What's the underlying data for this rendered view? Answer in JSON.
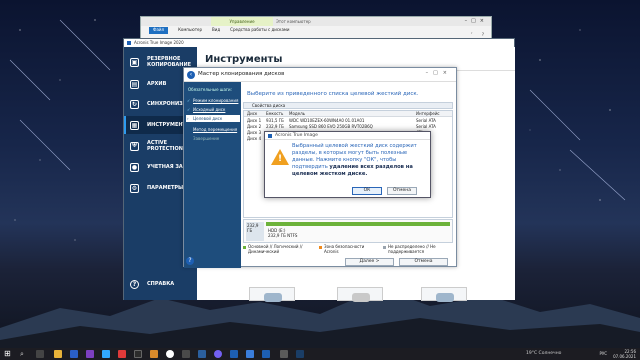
{
  "explorer": {
    "tab_manage": "Управление",
    "tab_title": "Этот компьютер",
    "ribbon": [
      "Файл",
      "Компьютер",
      "Вид",
      "Средства работы с дисками"
    ]
  },
  "app": {
    "title": "Acronis True Image 2020",
    "accent": "#1a3d66",
    "nav": [
      {
        "label": "РЕЗЕРВНОЕ КОПИРОВАНИЕ",
        "icon": "backup-icon"
      },
      {
        "label": "АРХИВ",
        "icon": "archive-icon"
      },
      {
        "label": "СИНХРОНИЗАЦИЯ",
        "icon": "sync-icon"
      },
      {
        "label": "ИНСТРУМЕНТЫ",
        "icon": "tools-icon"
      },
      {
        "label": "ACTIVE PROTECTION",
        "icon": "shield-icon"
      },
      {
        "label": "УЧЕТНАЯ ЗАПИ",
        "icon": "account-icon"
      },
      {
        "label": "ПАРАМЕТРЫ",
        "icon": "gear-icon"
      }
    ],
    "help_label": "СПРАВКА",
    "page_title": "Инструменты"
  },
  "wizard": {
    "title": "Мастер клонирования дисков",
    "steps_header": "Обязательные шаги:",
    "steps": [
      {
        "label": "Режим клонирования",
        "done": true
      },
      {
        "label": "Исходный диск",
        "done": true
      },
      {
        "label": "Целевой диск",
        "done": false,
        "active": true
      },
      {
        "label": "Метод перемещения",
        "done": false
      },
      {
        "label": "Завершение",
        "done": false
      }
    ],
    "prompt": "Выберите из приведенного списка целевой жесткий диск.",
    "toolbar_label": "Свойства диска",
    "columns": [
      "Диск",
      "Емкость",
      "Модель",
      "Интерфейс"
    ],
    "disks": [
      {
        "disk": "Диск 1",
        "capacity": "931,5 ГБ",
        "model": "WDC WD10EZEX-60WN4A0 01.01A01",
        "interface": "Serial ATA"
      },
      {
        "disk": "Диск 2",
        "capacity": "232,9 ГБ",
        "model": "Samsung SSD 860 EVO 250GB RVT02B6Q",
        "interface": "Serial ATA"
      },
      {
        "disk": "Диск 3",
        "capacity": "",
        "model": "",
        "interface": "ATA"
      },
      {
        "disk": "Диск 4",
        "capacity": "",
        "model": "",
        "interface": "ATA"
      }
    ],
    "partition": {
      "size": "232,9 ГБ",
      "name": "HDD (E:)",
      "details": "232,9 ГБ NTFS"
    },
    "legend": [
      {
        "label": "Основной // Логический // Динамический",
        "color": "#6cb23a"
      },
      {
        "label": "Зона безопасности Acronis",
        "color": "#f08a1c"
      },
      {
        "label": "Не распределено // Не поддерживается",
        "color": "#9aa4ae"
      }
    ],
    "next_label": "Далее >",
    "cancel_label": "Отмена"
  },
  "dialog": {
    "title": "Acronis True Image",
    "message": "Выбранный целевой жесткий диск содержит разделы, в которых могут быть полезные данные. Нажмите кнопку \"ОК\", чтобы подтвердить",
    "message_bold": "удаление всех разделов на целевом жестком диске.",
    "ok_label": "ОК",
    "cancel_label": "Отмена"
  },
  "taskbar": {
    "weather": "19°C  Солнечно",
    "lang": "РУС",
    "time": "22:56",
    "date": "07.06.2021"
  }
}
